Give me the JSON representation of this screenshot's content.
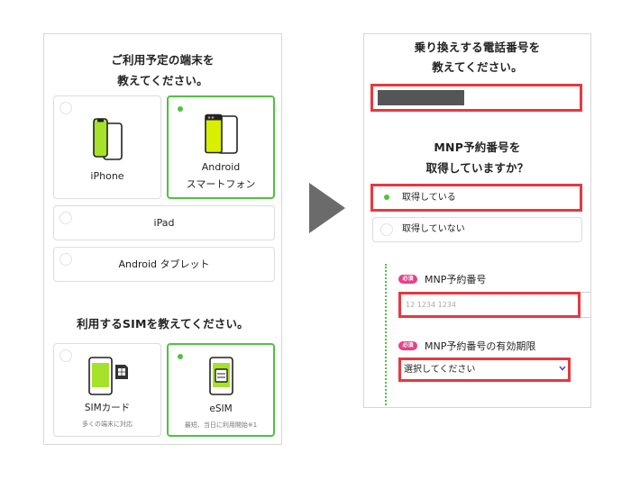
{
  "left_panel": {
    "device_heading": [
      "ご利用予定の端末を",
      "教えてください。"
    ],
    "device_options": [
      {
        "label_lines": [
          "iPhone"
        ],
        "selected": false,
        "icon": "iphone-icon"
      },
      {
        "label_lines": [
          "Android",
          "スマートフォン"
        ],
        "selected": true,
        "icon": "android-phone-icon"
      }
    ],
    "tablet_options": [
      {
        "label": "iPad",
        "selected": false
      },
      {
        "label": "Android タブレット",
        "selected": false
      }
    ],
    "sim_heading": "利用するSIMを教えてください。",
    "sim_options": [
      {
        "label": "SIMカード",
        "note": "多くの端末に対応",
        "selected": false,
        "icon": "sim-card-icon"
      },
      {
        "label": "eSIM",
        "note": "最短、当日に利用開始※1",
        "selected": true,
        "icon": "esim-icon"
      }
    ]
  },
  "arrow": {
    "icon": "right-arrow-icon"
  },
  "right_panel": {
    "phone_heading": [
      "乗り換えする電話番号を",
      "教えてください。"
    ],
    "mnp_heading": [
      "MNP予約番号を",
      "取得していますか？"
    ],
    "mnp_options": [
      {
        "label": "取得している",
        "selected": true
      },
      {
        "label": "取得していない",
        "selected": false
      }
    ],
    "mnp_number": {
      "badge": "必須",
      "label": "MNP予約番号",
      "placeholder": "12 1234 1234"
    },
    "mnp_expiry": {
      "badge": "必須",
      "label": "MNP予約番号の有効期限",
      "value": "選択してください",
      "icon": "chevron-down-icon"
    }
  },
  "colors": {
    "accent": "#4cc43c",
    "highlight": "#e8383d",
    "badge": "#e8408a",
    "chevron": "#6b3fd4",
    "icon_lime": "#a6e22a",
    "icon_yellow": "#d8ef00"
  }
}
